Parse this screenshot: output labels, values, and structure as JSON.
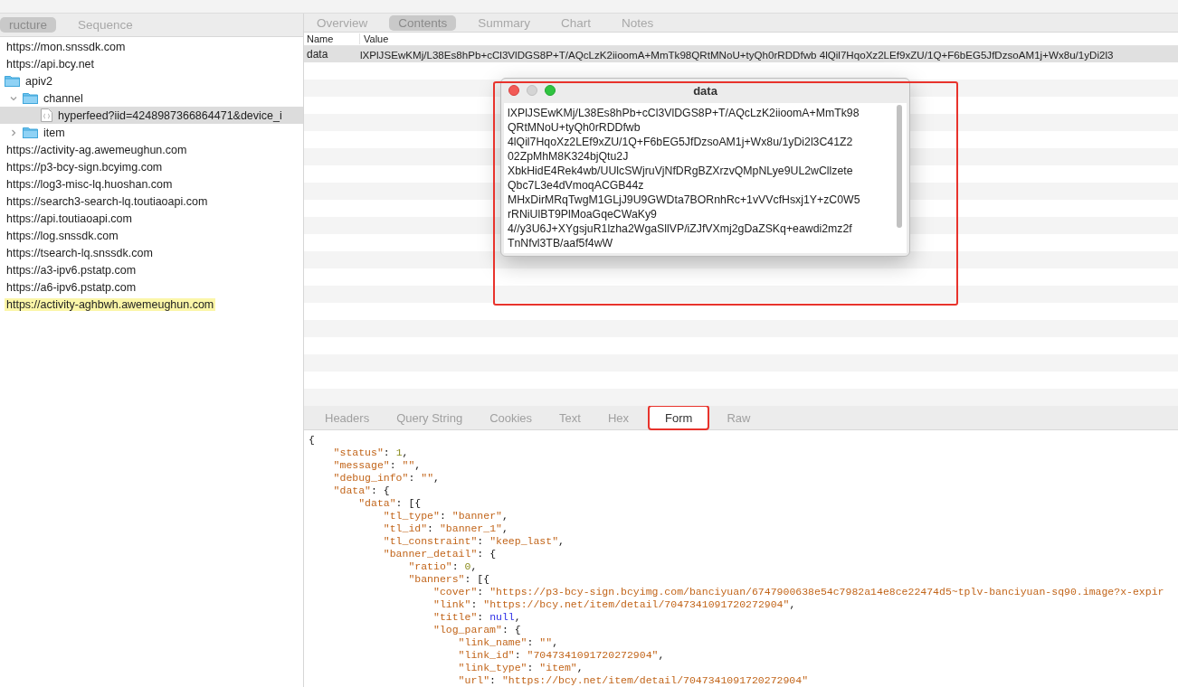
{
  "left_tabs": [
    {
      "label": "ructure",
      "selected": true
    },
    {
      "label": "Sequence",
      "selected": false
    }
  ],
  "tree": [
    {
      "kind": "host",
      "label": "https://mon.snssdk.com",
      "selected": false
    },
    {
      "kind": "host",
      "label": "https://api.bcy.net",
      "selected": false,
      "children": [
        {
          "kind": "folder",
          "label": "apiv2",
          "selected": false,
          "children": [
            {
              "kind": "folder",
              "label": "channel",
              "expanded": true,
              "selected": false,
              "children": [
                {
                  "kind": "file",
                  "label": "hyperfeed?iid=4248987366864471&device_i",
                  "selected": true
                }
              ]
            },
            {
              "kind": "folder",
              "label": "item",
              "expanded": false,
              "selected": false
            }
          ]
        }
      ]
    },
    {
      "kind": "host",
      "label": "https://activity-ag.awemeughun.com",
      "selected": false
    },
    {
      "kind": "host",
      "label": "https://p3-bcy-sign.bcyimg.com",
      "selected": false
    },
    {
      "kind": "host",
      "label": "https://log3-misc-lq.huoshan.com",
      "selected": false
    },
    {
      "kind": "host",
      "label": "https://search3-search-lq.toutiaoapi.com",
      "selected": false
    },
    {
      "kind": "host",
      "label": "https://api.toutiaoapi.com",
      "selected": false
    },
    {
      "kind": "host",
      "label": "https://log.snssdk.com",
      "selected": false
    },
    {
      "kind": "host",
      "label": "https://tsearch-lq.snssdk.com",
      "selected": false
    },
    {
      "kind": "host",
      "label": "https://a3-ipv6.pstatp.com",
      "selected": false
    },
    {
      "kind": "host",
      "label": "https://a6-ipv6.pstatp.com",
      "selected": false
    },
    {
      "kind": "host",
      "label": "https://activity-aghbwh.awemeughun.com",
      "selected": false,
      "highlighted": true
    }
  ],
  "top_tabs": [
    {
      "label": "Overview",
      "selected": false
    },
    {
      "label": "Contents",
      "selected": true
    },
    {
      "label": "Summary",
      "selected": false
    },
    {
      "label": "Chart",
      "selected": false
    },
    {
      "label": "Notes",
      "selected": false
    }
  ],
  "table": {
    "columns": [
      "Name",
      "Value"
    ],
    "rows": [
      {
        "name": "data",
        "value": "lXPlJSEwKMj/L38Es8hPb+cCl3VlDGS8P+T/AQcLzK2iioomA+MmTk98QRtMNoU+tyQh0rRDDfwb 4lQil7HqoXz2LEf9xZU/1Q+F6bEG5JfDzsoAM1j+Wx8u/1yDi2l3"
      }
    ]
  },
  "popup": {
    "title": "data",
    "lines": [
      "lXPlJSEwKMj/L38Es8hPb+cCl3VlDGS8P+T/AQcLzK2iioomA+MmTk98",
      "QRtMNoU+tyQh0rRDDfwb",
      "4lQil7HqoXz2LEf9xZU/1Q+F6bEG5JfDzsoAM1j+Wx8u/1yDi2l3C41Z2",
      "02ZpMhM8K324bjQtu2J",
      "XbkHidE4Rek4wb/UUlcSWjruVjNfDRgBZXrzvQMpNLye9UL2wCllzete",
      "Qbc7L3e4dVmoqACGB44z",
      "MHxDirMRqTwgM1GLjJ9U9GWDta7BORnhRc+1vVVcfHsxj1Y+zC0W5",
      "rRNiUlBT9PlMoaGqeCWaKy9",
      "4//y3U6J+XYgsjuR1lzha2WgaSllVP/iZJfVXmj2gDaZSKq+eawdi2mz2f",
      "TnNfvl3TB/aaf5f4wW"
    ]
  },
  "bottom_tabs": [
    {
      "label": "Headers",
      "selected": false
    },
    {
      "label": "Query String",
      "selected": false
    },
    {
      "label": "Cookies",
      "selected": false
    },
    {
      "label": "Text",
      "selected": false
    },
    {
      "label": "Hex",
      "selected": false
    },
    {
      "label": "Form",
      "selected": true
    },
    {
      "label": "Raw",
      "selected": false
    }
  ],
  "code": [
    {
      "tokens": [
        {
          "kind": "punct",
          "text": "{"
        }
      ],
      "children": [
        {
          "tokens": [
            {
              "kind": "key",
              "text": "\"status\""
            },
            {
              "kind": "punct",
              "text": ": "
            },
            {
              "kind": "num",
              "text": "1"
            },
            {
              "kind": "punct",
              "text": ","
            }
          ]
        },
        {
          "tokens": [
            {
              "kind": "key",
              "text": "\"message\""
            },
            {
              "kind": "punct",
              "text": ": "
            },
            {
              "kind": "str",
              "text": "\"\""
            },
            {
              "kind": "punct",
              "text": ","
            }
          ]
        },
        {
          "tokens": [
            {
              "kind": "key",
              "text": "\"debug_info\""
            },
            {
              "kind": "punct",
              "text": ": "
            },
            {
              "kind": "str",
              "text": "\"\""
            },
            {
              "kind": "punct",
              "text": ","
            }
          ]
        },
        {
          "tokens": [
            {
              "kind": "key",
              "text": "\"data\""
            },
            {
              "kind": "punct",
              "text": ": {"
            }
          ],
          "children": [
            {
              "tokens": [
                {
                  "kind": "key",
                  "text": "\"data\""
                },
                {
                  "kind": "punct",
                  "text": ": [{"
                }
              ],
              "children": [
                {
                  "tokens": [
                    {
                      "kind": "key",
                      "text": "\"tl_type\""
                    },
                    {
                      "kind": "punct",
                      "text": ": "
                    },
                    {
                      "kind": "str",
                      "text": "\"banner\""
                    },
                    {
                      "kind": "punct",
                      "text": ","
                    }
                  ]
                },
                {
                  "tokens": [
                    {
                      "kind": "key",
                      "text": "\"tl_id\""
                    },
                    {
                      "kind": "punct",
                      "text": ": "
                    },
                    {
                      "kind": "str",
                      "text": "\"banner_1\""
                    },
                    {
                      "kind": "punct",
                      "text": ","
                    }
                  ]
                },
                {
                  "tokens": [
                    {
                      "kind": "key",
                      "text": "\"tl_constraint\""
                    },
                    {
                      "kind": "punct",
                      "text": ": "
                    },
                    {
                      "kind": "str",
                      "text": "\"keep_last\""
                    },
                    {
                      "kind": "punct",
                      "text": ","
                    }
                  ]
                },
                {
                  "tokens": [
                    {
                      "kind": "key",
                      "text": "\"banner_detail\""
                    },
                    {
                      "kind": "punct",
                      "text": ": {"
                    }
                  ],
                  "children": [
                    {
                      "tokens": [
                        {
                          "kind": "key",
                          "text": "\"ratio\""
                        },
                        {
                          "kind": "punct",
                          "text": ": "
                        },
                        {
                          "kind": "num",
                          "text": "0"
                        },
                        {
                          "kind": "punct",
                          "text": ","
                        }
                      ]
                    },
                    {
                      "tokens": [
                        {
                          "kind": "key",
                          "text": "\"banners\""
                        },
                        {
                          "kind": "punct",
                          "text": ": [{"
                        }
                      ],
                      "children": [
                        {
                          "tokens": [
                            {
                              "kind": "key",
                              "text": "\"cover\""
                            },
                            {
                              "kind": "punct",
                              "text": ": "
                            },
                            {
                              "kind": "str",
                              "text": "\"https://p3-bcy-sign.bcyimg.com/banciyuan/6747900638e54c7982a14e8ce22474d5~tplv-banciyuan-sq90.image?x-expir"
                            }
                          ]
                        },
                        {
                          "tokens": [
                            {
                              "kind": "key",
                              "text": "\"link\""
                            },
                            {
                              "kind": "punct",
                              "text": ": "
                            },
                            {
                              "kind": "str",
                              "text": "\"https://bcy.net/item/detail/7047341091720272904\""
                            },
                            {
                              "kind": "punct",
                              "text": ","
                            }
                          ]
                        },
                        {
                          "tokens": [
                            {
                              "kind": "key",
                              "text": "\"title\""
                            },
                            {
                              "kind": "punct",
                              "text": ": "
                            },
                            {
                              "kind": "null",
                              "text": "null"
                            },
                            {
                              "kind": "punct",
                              "text": ","
                            }
                          ]
                        },
                        {
                          "tokens": [
                            {
                              "kind": "key",
                              "text": "\"log_param\""
                            },
                            {
                              "kind": "punct",
                              "text": ": {"
                            }
                          ],
                          "children": [
                            {
                              "tokens": [
                                {
                                  "kind": "key",
                                  "text": "\"link_name\""
                                },
                                {
                                  "kind": "punct",
                                  "text": ": "
                                },
                                {
                                  "kind": "str",
                                  "text": "\"\""
                                },
                                {
                                  "kind": "punct",
                                  "text": ","
                                }
                              ]
                            },
                            {
                              "tokens": [
                                {
                                  "kind": "key",
                                  "text": "\"link_id\""
                                },
                                {
                                  "kind": "punct",
                                  "text": ": "
                                },
                                {
                                  "kind": "str",
                                  "text": "\"7047341091720272904\""
                                },
                                {
                                  "kind": "punct",
                                  "text": ","
                                }
                              ]
                            },
                            {
                              "tokens": [
                                {
                                  "kind": "key",
                                  "text": "\"link_type\""
                                },
                                {
                                  "kind": "punct",
                                  "text": ": "
                                },
                                {
                                  "kind": "str",
                                  "text": "\"item\""
                                },
                                {
                                  "kind": "punct",
                                  "text": ","
                                }
                              ]
                            },
                            {
                              "tokens": [
                                {
                                  "kind": "key",
                                  "text": "\"url\""
                                },
                                {
                                  "kind": "punct",
                                  "text": ": "
                                },
                                {
                                  "kind": "str",
                                  "text": "\"https://bcy.net/item/detail/7047341091720272904\""
                                }
                              ]
                            }
                          ]
                        }
                      ]
                    }
                  ]
                }
              ]
            }
          ]
        }
      ]
    }
  ]
}
